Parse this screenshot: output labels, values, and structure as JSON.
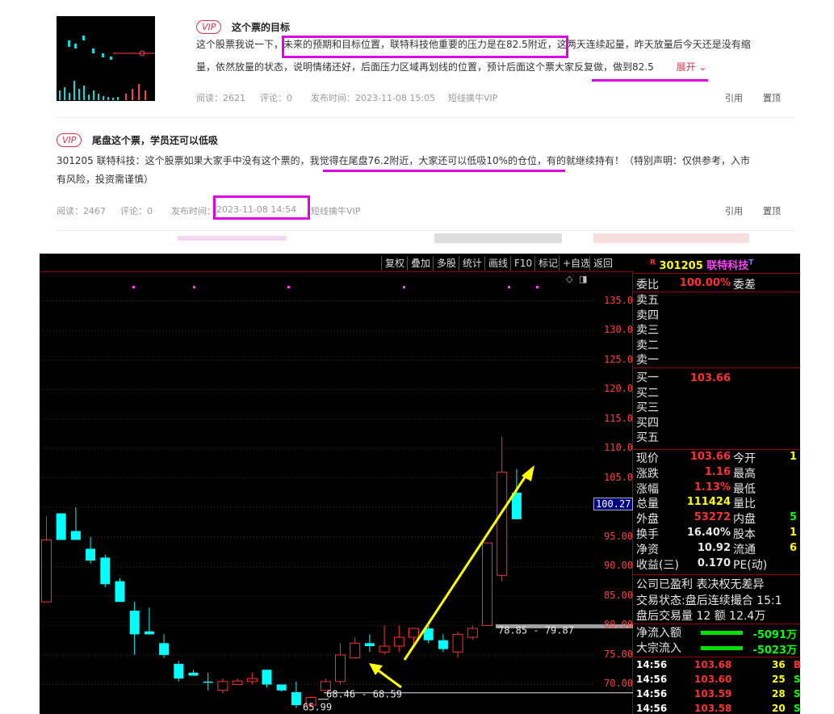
{
  "post1": {
    "vip_label": "VIP",
    "title": "这个票的目标",
    "text_a": "这个股票我说一下，",
    "text_hl": "未来的预期和目标位置，联特科技他重要的压力是在82.5附近",
    "text_b": "，这两天连续起量，昨天放量后今天还是没有缩",
    "line2_a": "量，依然放量的状态，说明情绪还好，后面压力区域再划线的位置，预计后面这个票大家反复做，做到82.5",
    "expand_label": "展开",
    "read": "阅读：2621",
    "comments": "评论：0",
    "time": "发布时间：2023-11-08 15:05",
    "source": "短线擒牛VIP",
    "quote_label": "引用",
    "pin_label": "置顶"
  },
  "post2": {
    "vip_label": "VIP",
    "title": "尾盘这个票，学员还可以低吸",
    "text_a": "301205 联特科技：这个股票如果大家手中没有这个票的，",
    "text_ul": "我觉得在尾盘76.2附近，大家还可以低吸10%的仓位",
    "text_b": "，有的就继续持有！（特别声明：仅供参考，入市",
    "line2": "有风险，投资需谨慎）",
    "read": "阅读：2467",
    "comments": "评论：0",
    "time_label": "发布时间：",
    "time_value": "2023-11-08 14:54",
    "source": "短线擒牛VIP",
    "quote_label": "引用",
    "pin_label": "置顶"
  },
  "toolbar": [
    "复权",
    "叠加",
    "多股",
    "统计",
    "画线",
    "F10",
    "标记",
    "+自选",
    "返回"
  ],
  "stock": {
    "marker": "R",
    "code": "301205",
    "name": "联特科技",
    "suffix": "T"
  },
  "axis": {
    "labels": [
      "135.0",
      "130.0",
      "125.0",
      "120.0",
      "115.0",
      "110.0",
      "105.0",
      "100.0",
      "95.00",
      "90.00",
      "85.00",
      "80.00",
      "75.00",
      "70.00"
    ],
    "current_price_tag": "100.27"
  },
  "annotations": {
    "range1": "78.85 - 79.87",
    "range2": "68.46 - 68.59",
    "low": "65.99"
  },
  "quote": {
    "wb_label": "委比",
    "wb_value": "100.00%",
    "wc_label": "委差",
    "sell": [
      "卖五",
      "卖四",
      "卖三",
      "卖二",
      "卖一"
    ],
    "buy": [
      "买一",
      "买二",
      "买三",
      "买四",
      "买五"
    ],
    "buy1_price": "103.66",
    "rows": [
      {
        "l": "现价",
        "v": "103.66",
        "v_color": "#ff3030",
        "r": "今开"
      },
      {
        "l": "涨跌",
        "v": "1.16",
        "v_color": "#ff3030",
        "r": "最高"
      },
      {
        "l": "涨幅",
        "v": "1.13%",
        "v_color": "#ff3030",
        "r": "最低"
      },
      {
        "l": "总量",
        "v": "111424",
        "v_color": "#ffff00",
        "r": "量比"
      },
      {
        "l": "外盘",
        "v": "53272",
        "v_color": "#ff3030",
        "r": "内盘"
      },
      {
        "l": "换手",
        "v": "16.40%",
        "v_color": "#e8e8e8",
        "r": "股本"
      },
      {
        "l": "净资",
        "v": "10.92",
        "v_color": "#e8e8e8",
        "r": "流通"
      },
      {
        "l": "收益(三)",
        "v": "0.170",
        "v_color": "#e8e8e8",
        "r": "PE(动)"
      }
    ],
    "right_edge": [
      "1",
      "",
      "",
      "",
      "5",
      "1",
      "6",
      ""
    ],
    "profit_line": "公司已盈利 表决权无差异",
    "trade_status": "交易状态:盘后连续撮合 15:1",
    "after_hours": "盘后交易量 12 额 12.4万",
    "net_inflow_label": "净流入额",
    "net_inflow_value": "-5091万",
    "block_inflow_label": "大宗流入",
    "block_inflow_value": "-5023万"
  },
  "ticks": [
    {
      "t": "14:56",
      "p": "103.68",
      "v": "36",
      "s": "B"
    },
    {
      "t": "14:56",
      "p": "103.60",
      "v": "25",
      "s": "S"
    },
    {
      "t": "14:56",
      "p": "103.59",
      "v": "28",
      "s": "S"
    },
    {
      "t": "14:56",
      "p": "103.58",
      "v": "20",
      "s": "S"
    }
  ],
  "chart_data": {
    "type": "candlestick",
    "y_range": [
      65,
      140
    ],
    "candles": [
      {
        "o": 94.5,
        "h": 98.5,
        "l": 84,
        "c": 84,
        "up": true
      },
      {
        "o": 99,
        "h": 99,
        "l": 94.5,
        "c": 94.5,
        "up": false
      },
      {
        "o": 96,
        "h": 100,
        "l": 94.5,
        "c": 94.5,
        "up": false
      },
      {
        "o": 93,
        "h": 95,
        "l": 90.5,
        "c": 91,
        "up": false
      },
      {
        "o": 91.5,
        "h": 92,
        "l": 86.5,
        "c": 87,
        "up": false
      },
      {
        "o": 87.5,
        "h": 88,
        "l": 84,
        "c": 84,
        "up": false
      },
      {
        "o": 82.5,
        "h": 84,
        "l": 75,
        "c": 78.5,
        "up": false
      },
      {
        "o": 79,
        "h": 83,
        "l": 78.5,
        "c": 78.5,
        "up": false
      },
      {
        "o": 77,
        "h": 78.5,
        "l": 74.5,
        "c": 75,
        "up": false
      },
      {
        "o": 73.5,
        "h": 74,
        "l": 70.5,
        "c": 71,
        "up": false
      },
      {
        "o": 72,
        "h": 72.5,
        "l": 71.5,
        "c": 71.5,
        "up": false
      },
      {
        "o": 70.5,
        "h": 72,
        "l": 69,
        "c": 70.5,
        "up": false
      },
      {
        "o": 69,
        "h": 71,
        "l": 68.5,
        "c": 70.5,
        "up": true
      },
      {
        "o": 70,
        "h": 71,
        "l": 70,
        "c": 70.6,
        "up": true
      },
      {
        "o": 70.5,
        "h": 72,
        "l": 70,
        "c": 71,
        "up": true
      },
      {
        "o": 72.5,
        "h": 72.5,
        "l": 69.5,
        "c": 70,
        "up": false
      },
      {
        "o": 70,
        "h": 70,
        "l": 68.8,
        "c": 69,
        "up": false
      },
      {
        "o": 68.7,
        "h": 70.5,
        "l": 66,
        "c": 66.5,
        "up": false
      },
      {
        "o": 66.5,
        "h": 68,
        "l": 66,
        "c": 67.8,
        "up": true
      },
      {
        "o": 69,
        "h": 71,
        "l": 69,
        "c": 70.5,
        "up": true
      },
      {
        "o": 70.5,
        "h": 77,
        "l": 70,
        "c": 75,
        "up": true
      },
      {
        "o": 74.5,
        "h": 78,
        "l": 74.5,
        "c": 77,
        "up": true
      },
      {
        "o": 77,
        "h": 78.5,
        "l": 75.5,
        "c": 76.5,
        "up": false
      },
      {
        "o": 75.5,
        "h": 80,
        "l": 75,
        "c": 76.5,
        "up": true
      },
      {
        "o": 76.5,
        "h": 80,
        "l": 75.5,
        "c": 78,
        "up": true
      },
      {
        "o": 78,
        "h": 79.5,
        "l": 76.5,
        "c": 79.5,
        "up": true
      },
      {
        "o": 79.5,
        "h": 80.5,
        "l": 77,
        "c": 77.5,
        "up": false
      },
      {
        "o": 77.5,
        "h": 78.5,
        "l": 75.5,
        "c": 76,
        "up": false
      },
      {
        "o": 75.5,
        "h": 79,
        "l": 74.5,
        "c": 78.5,
        "up": true
      },
      {
        "o": 78,
        "h": 80,
        "l": 77.5,
        "c": 79.5,
        "up": true
      },
      {
        "o": 80,
        "h": 94,
        "l": 80,
        "c": 94,
        "up": true
      },
      {
        "o": 88.5,
        "h": 112,
        "l": 87.5,
        "c": 106,
        "up": true
      },
      {
        "o": 102.5,
        "h": 106.5,
        "l": 100,
        "c": 98,
        "up": false
      }
    ]
  }
}
